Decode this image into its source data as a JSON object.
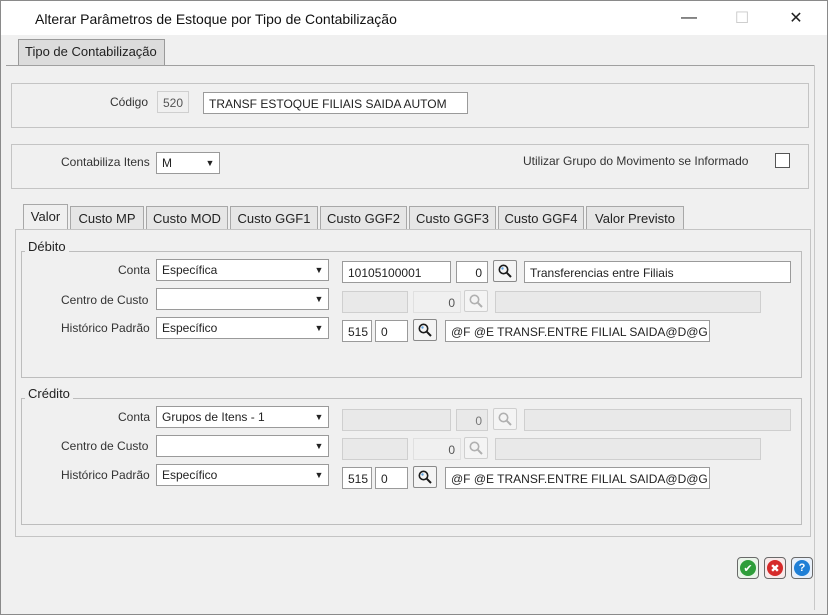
{
  "window": {
    "title": "Alterar Parâmetros de Estoque por Tipo de Contabilização",
    "minimize_icon": "minimize-icon",
    "maximize_icon": "maximize-icon",
    "close_icon": "close-icon"
  },
  "top_tab": {
    "label": "Tipo de Contabilização"
  },
  "header": {
    "codigo_label": "Código",
    "codigo_value": "520",
    "descricao_value": "TRANSF ESTOQUE FILIAIS SAIDA AUTOM"
  },
  "options": {
    "contabiliza_label": "Contabiliza Itens",
    "contabiliza_value": "M",
    "utilizar_grupo_label": "Utilizar Grupo do Movimento se Informado",
    "utilizar_grupo_checked": false
  },
  "tabs": [
    {
      "label": "Valor",
      "active": true
    },
    {
      "label": "Custo MP"
    },
    {
      "label": "Custo MOD"
    },
    {
      "label": "Custo GGF1"
    },
    {
      "label": "Custo GGF2"
    },
    {
      "label": "Custo GGF3"
    },
    {
      "label": "Custo GGF4"
    },
    {
      "label": "Valor Previsto"
    }
  ],
  "debito": {
    "title": "Débito",
    "conta_label": "Conta",
    "conta_type": "Específica",
    "conta_code": "10105100001",
    "conta_digit": "0",
    "conta_desc": "Transferencias entre Filiais",
    "centro_label": "Centro de Custo",
    "centro_type": "",
    "centro_digit": "0",
    "historico_label": "Histórico Padrão",
    "historico_type": "Específico",
    "historico_code": "515",
    "historico_digit": "0",
    "historico_text": "@F @E TRANSF.ENTRE FILIAL SAIDA@D@G"
  },
  "credito": {
    "title": "Crédito",
    "conta_label": "Conta",
    "conta_type": "Grupos de Itens - 1",
    "conta_digit": "0",
    "centro_label": "Centro de Custo",
    "centro_type": "",
    "centro_digit": "0",
    "historico_label": "Histórico Padrão",
    "historico_type": "Específico",
    "historico_code": "515",
    "historico_digit": "0",
    "historico_text": "@F @E TRANSF.ENTRE FILIAL SAIDA@D@G"
  },
  "actions": {
    "confirm_icon": "check-icon",
    "cancel_icon": "cancel-icon",
    "help_icon": "help-icon"
  },
  "colors": {
    "confirm": "#2e9e3a",
    "cancel": "#d62a2a",
    "help": "#1f7fd6"
  }
}
